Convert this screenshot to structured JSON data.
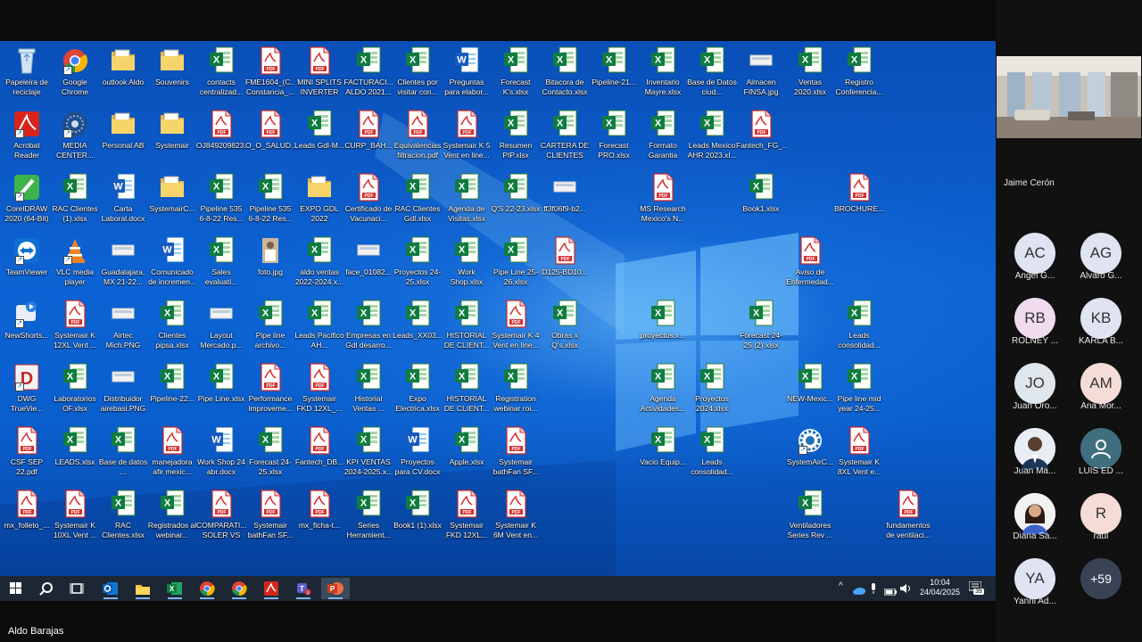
{
  "desktop": {
    "icons": [
      {
        "label": "Papeleira de reciclaje",
        "type": "recycle"
      },
      {
        "label": "Google Chrome",
        "type": "chrome"
      },
      {
        "label": "outlook Aldo",
        "type": "folder"
      },
      {
        "label": "Souvenirs",
        "type": "folder"
      },
      {
        "label": "contacts centralizad...",
        "type": "excel"
      },
      {
        "label": "FME1604_(C... Constancia_...",
        "type": "pdf"
      },
      {
        "label": "MINI SPLITS INVERTER L...",
        "type": "pdf"
      },
      {
        "label": "FACTURACI... ALDO 2021...",
        "type": "excel"
      },
      {
        "label": "Clientes por visitar con...",
        "type": "excel"
      },
      {
        "label": "Preguntas para elabor...",
        "type": "word"
      },
      {
        "label": "Forecast K's.xlsx",
        "type": "excel"
      },
      {
        "label": "Bitacora de Contacto.xlsx",
        "type": "excel"
      },
      {
        "label": "Pipeline-21...",
        "type": "excel"
      },
      {
        "label": "Inventario Mayre.xlsx",
        "type": "excel"
      },
      {
        "label": "Base de Datos ciud...",
        "type": "excel"
      },
      {
        "label": "Almacen FINSA.jpg",
        "type": "image"
      },
      {
        "label": "Ventas 2020.xlsx",
        "type": "excel"
      },
      {
        "label": "Registro Conferencia...",
        "type": "excel"
      },
      {
        "label": "Acrobat Reader",
        "type": "acrobat"
      },
      {
        "label": "MEDIA CENTER...",
        "type": "media"
      },
      {
        "label": "Personal AB",
        "type": "folder"
      },
      {
        "label": "Systemair",
        "type": "folder"
      },
      {
        "label": "OJ849209823...",
        "type": "pdf"
      },
      {
        "label": "O_O_SALUD...",
        "type": "pdf"
      },
      {
        "label": "Leads Gdl-M...",
        "type": "excel"
      },
      {
        "label": "CURP_BAH...",
        "type": "pdf"
      },
      {
        "label": "Equivalencias filtracion.pdf",
        "type": "pdf"
      },
      {
        "label": "Systemair K 5 Vent en line...",
        "type": "pdf"
      },
      {
        "label": "Resumen PIP.xlsx",
        "type": "excel"
      },
      {
        "label": "CARTERA DE CLIENTES R...",
        "type": "excel"
      },
      {
        "label": "Forecast PRO.xlsx",
        "type": "excel"
      },
      {
        "label": "Formato Garantia Sys...",
        "type": "excel"
      },
      {
        "label": "Leads Mexico AHR 2023.xl...",
        "type": "excel"
      },
      {
        "label": "Fantech_FG_...",
        "type": "pdf"
      },
      {
        "label": "CorelDRAW 2020 (64-Bit)",
        "type": "corel"
      },
      {
        "label": "RAC Clientes (1).xlsx",
        "type": "excel"
      },
      {
        "label": "Carta Laboral.docx",
        "type": "word"
      },
      {
        "label": "SystemairC...",
        "type": "folder"
      },
      {
        "label": "Pipeline 535 6-8-22 Res...",
        "type": "excel"
      },
      {
        "label": "Pipeline 535 6-8-22 Res...",
        "type": "excel"
      },
      {
        "label": "EXPO GDL 2022",
        "type": "folder"
      },
      {
        "label": "Certificado de Vacunaci...",
        "type": "pdf"
      },
      {
        "label": "RAC Clientes Gdl.xlsx",
        "type": "excel"
      },
      {
        "label": "Agenda de Visitas.xlsx",
        "type": "excel"
      },
      {
        "label": "Q'S 22-23.xlsx",
        "type": "excel"
      },
      {
        "label": "ff3f06f9-b2...",
        "type": "image"
      },
      {
        "label": "MS Research Mexico's N...",
        "type": "pdf"
      },
      {
        "label": "Book1.xlsx",
        "type": "excel"
      },
      {
        "label": "BROCHURE...",
        "type": "pdf"
      },
      {
        "label": "TeamViewer",
        "type": "teamviewer"
      },
      {
        "label": "VLC media player",
        "type": "vlc"
      },
      {
        "label": "Guadalajara, MX 21-22...",
        "type": "image"
      },
      {
        "label": "Comunicado de incremen...",
        "type": "word"
      },
      {
        "label": "Sales evaluati...",
        "type": "excel"
      },
      {
        "label": "foto.jpg",
        "type": "photo"
      },
      {
        "label": "aldo ventas 2022-2024.x...",
        "type": "excel"
      },
      {
        "label": "face_01082...",
        "type": "image"
      },
      {
        "label": "Proyectos 24-25.xlsx",
        "type": "excel"
      },
      {
        "label": "Work Shop.xlsx",
        "type": "excel"
      },
      {
        "label": "Pipe Line 25-26.xlsx",
        "type": "excel"
      },
      {
        "label": "D125-BD10...",
        "type": "pdf"
      },
      {
        "label": "Aviso de Enfermedad...",
        "type": "pdf"
      },
      {
        "label": "NewShorts...",
        "type": "newshorts"
      },
      {
        "label": "Systemair K 12XL Vent ...",
        "type": "pdf"
      },
      {
        "label": "Airtec Mich.PNG",
        "type": "image"
      },
      {
        "label": "Clientes pipsa.xlsx",
        "type": "excel"
      },
      {
        "label": "Layout Mercado.p...",
        "type": "image"
      },
      {
        "label": "Pipe line archivo...",
        "type": "excel"
      },
      {
        "label": "Leads Pacifico AH...",
        "type": "excel"
      },
      {
        "label": "Empresas en Gdl desarro...",
        "type": "excel"
      },
      {
        "label": "Leads_XX03...",
        "type": "excel"
      },
      {
        "label": "HISTORIAL DE CLIENT...",
        "type": "excel"
      },
      {
        "label": "Systemair K 4 Vent en line...",
        "type": "pdf"
      },
      {
        "label": "Obras x Q's.xlsx",
        "type": "excel"
      },
      {
        "label": "proyectos.x...",
        "type": "excel"
      },
      {
        "label": "Forecast 24-25 (2).xlsx",
        "type": "excel"
      },
      {
        "label": "Leads consolidad...",
        "type": "excel"
      },
      {
        "label": "DWG TrueVie...",
        "type": "dwg"
      },
      {
        "label": "Laboratorios OF.xlsx",
        "type": "excel"
      },
      {
        "label": "Distribuidor airebasi.PNG",
        "type": "image"
      },
      {
        "label": "Pipeline-22...",
        "type": "excel"
      },
      {
        "label": "Pipe Line.xlsx",
        "type": "excel"
      },
      {
        "label": "Performance Improveme...",
        "type": "pdf"
      },
      {
        "label": "Systemair FKD 12XL_...",
        "type": "pdf"
      },
      {
        "label": "Historial Ventas ...",
        "type": "excel"
      },
      {
        "label": "Expo Electrica.xlsx",
        "type": "excel"
      },
      {
        "label": "HISTORIAL DE CLIENT...",
        "type": "excel"
      },
      {
        "label": "Registration webinar roi...",
        "type": "excel"
      },
      {
        "label": "Agenda Actividades...",
        "type": "excel"
      },
      {
        "label": "Proyectos 2024.xlsx",
        "type": "excel"
      },
      {
        "label": "NEW-Mexic...",
        "type": "excel"
      },
      {
        "label": "Pipe line mid year 24-25...",
        "type": "excel"
      },
      {
        "label": "CSF SEP 22.pdf",
        "type": "pdf"
      },
      {
        "label": "LEADS.xlsx",
        "type": "excel"
      },
      {
        "label": "Base de datos ...",
        "type": "excel"
      },
      {
        "label": "manejadora afir mexic...",
        "type": "pdf"
      },
      {
        "label": "Work Shop 24 abr.docx",
        "type": "word"
      },
      {
        "label": "Forecast 24-25.xlsx",
        "type": "excel"
      },
      {
        "label": "Fantech_DB...",
        "type": "pdf"
      },
      {
        "label": "KPI VENTAS 2024-2025.x...",
        "type": "excel"
      },
      {
        "label": "Proyectos para CV.docx",
        "type": "word"
      },
      {
        "label": "Apple.xlsx",
        "type": "excel"
      },
      {
        "label": "Systemair bathFan SF...",
        "type": "pdf"
      },
      {
        "label": "Vacio Equip...",
        "type": "excel"
      },
      {
        "label": "Leads consolidad...",
        "type": "excel"
      },
      {
        "label": "SystemAirC...",
        "type": "systemair"
      },
      {
        "label": "Systemair K 8XL Vent e...",
        "type": "pdf"
      },
      {
        "label": "mx_folleto_...",
        "type": "pdf"
      },
      {
        "label": "Systemair K 10XL Vent ...",
        "type": "pdf"
      },
      {
        "label": "RAC Clientes.xlsx",
        "type": "excel"
      },
      {
        "label": "Registrados al webinar...",
        "type": "excel"
      },
      {
        "label": "COMPARATI... SOLER VS S...",
        "type": "pdf"
      },
      {
        "label": "Systemair bathFan SF...",
        "type": "pdf"
      },
      {
        "label": "mx_ficha-t...",
        "type": "pdf"
      },
      {
        "label": "Series Herramient...",
        "type": "excel"
      },
      {
        "label": "Book1 (1).xlsx",
        "type": "excel"
      },
      {
        "label": "Systemair FKD 12XL...",
        "type": "pdf"
      },
      {
        "label": "Systemair K 6M Vent en...",
        "type": "pdf"
      },
      {
        "label": "Ventiladores Series Rev ...",
        "type": "excel"
      },
      {
        "label": "fundamentos de ventilaci...",
        "type": "pdf"
      }
    ]
  },
  "taskbar": {
    "apps": [
      "start-icon",
      "search-icon",
      "task-view-icon",
      "outlook-icon",
      "file-explorer-icon",
      "excel-icon",
      "chrome-icon",
      "chrome-icon",
      "acrobat-icon",
      "teams-icon",
      "powerpoint-icon"
    ],
    "tray_caret": "^",
    "time": "10:04",
    "date": "24/04/2025",
    "notifications": "39"
  },
  "meeting": {
    "presenter": "Jaime Cerón",
    "participants": [
      {
        "initials": "AC",
        "name": "Angel G...",
        "color": "#dfe3f2"
      },
      {
        "initials": "AG",
        "name": "Alvaro G...",
        "color": "#dfe3f2"
      },
      {
        "initials": "RB",
        "name": "ROLNEY ...",
        "color": "#f1dcef"
      },
      {
        "initials": "KB",
        "name": "KARLA B...",
        "color": "#dfe3f2"
      },
      {
        "initials": "JO",
        "name": "Juan Oro...",
        "color": "#dfe7ec"
      },
      {
        "initials": "AM",
        "name": "Ana Mor...",
        "color": "#f5dcd6"
      },
      {
        "initials": "",
        "name": "Juan Ma...",
        "color": "#cfd8e3"
      },
      {
        "initials": "",
        "name": "LUIS ED ...",
        "color": "#3f6f7f"
      },
      {
        "initials": "",
        "name": "Diana Sa...",
        "color": "#e8e8e8"
      },
      {
        "initials": "R",
        "name": "raul",
        "color": "#f5dcd6"
      },
      {
        "initials": "YA",
        "name": "Yanni Ad...",
        "color": "#dfe3f2"
      },
      {
        "initials": "+59",
        "name": "",
        "color": "#3a4356"
      }
    ]
  },
  "speaker_name": "Aldo Barajas"
}
